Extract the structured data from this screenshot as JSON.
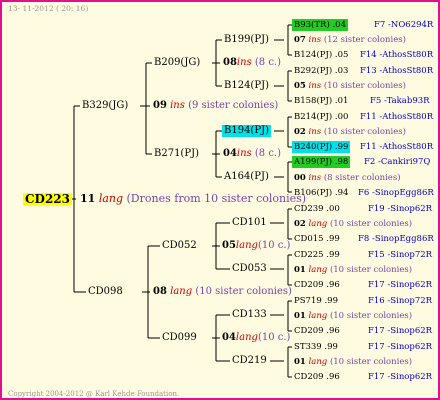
{
  "date": "13- 11-2012 ( 20: 16)",
  "copyright": "Copyright 2004-2012 @ Karl Kehde Foundation.",
  "root": {
    "id": "CD223",
    "num": "11",
    "type": "lang",
    "desc": "(Drones from 10 sister colonies)"
  },
  "b1": {
    "id": "B329(JG)",
    "num": "09",
    "type": "ins",
    "desc": "(9 sister colonies)"
  },
  "b2": {
    "id": "CD098",
    "num": "08",
    "type": "lang",
    "desc": "(10 sister colonies)"
  },
  "b11": {
    "id": "B209(JG)",
    "num": "08",
    "type": "ins",
    "desc": "(8 c.)"
  },
  "b12": {
    "id": "B271(PJ)",
    "num": "04",
    "type": "ins",
    "desc": "(8 c.)"
  },
  "b21": {
    "id": "CD052",
    "num": "05",
    "type": "lang",
    "desc": "(10 c.)"
  },
  "b22": {
    "id": "CD099",
    "num": "04",
    "type": "lang",
    "desc": "(10 c.)"
  },
  "g": [
    {
      "id": "B199(PJ)"
    },
    {
      "id": "B124(PJ)"
    },
    {
      "id": "B194(PJ)"
    },
    {
      "id": "A164(PJ)"
    },
    {
      "id": "CD101"
    },
    {
      "id": "CD053"
    },
    {
      "id": "CD133"
    },
    {
      "id": "CD219"
    }
  ],
  "r": [
    {
      "id": "B93(TR) .04",
      "num": "",
      "type": "",
      "desc": "",
      "ref": "F7 -NO6294R"
    },
    {
      "id": "",
      "num": "07",
      "type": "ins",
      "desc": "(12 sister colonies)",
      "ref": ""
    },
    {
      "id": "B124(PJ) .05",
      "num": "",
      "type": "",
      "desc": "",
      "ref": "F14 -AthosSt80R"
    },
    {
      "id": "B292(PJ) .03",
      "num": "",
      "type": "",
      "desc": "",
      "ref": "F13 -AthosSt80R"
    },
    {
      "id": "",
      "num": "05",
      "type": "ins",
      "desc": "(10 sister colonies)",
      "ref": ""
    },
    {
      "id": "B158(PJ) .01",
      "num": "",
      "type": "",
      "desc": "",
      "ref": "F5 -Takab93R"
    },
    {
      "id": "B214(PJ) .00",
      "num": "",
      "type": "",
      "desc": "",
      "ref": "F11 -AthosSt80R"
    },
    {
      "id": "",
      "num": "02",
      "type": "ins",
      "desc": "(10 sister colonies)",
      "ref": ""
    },
    {
      "id": "B240(PJ) .99",
      "num": "",
      "type": "",
      "desc": "",
      "ref": "F11 -AthosSt80R"
    },
    {
      "id": "A199(PJ) .98",
      "num": "",
      "type": "",
      "desc": "",
      "ref": "F2 -Cankiri97Q"
    },
    {
      "id": "",
      "num": "00",
      "type": "ins",
      "desc": "(8 sister colonies)",
      "ref": ""
    },
    {
      "id": "B106(PJ) .94",
      "num": "",
      "type": "",
      "desc": "",
      "ref": "F6 -SinopEgg86R"
    },
    {
      "id": "CD239 .00",
      "num": "",
      "type": "",
      "desc": "",
      "ref": "F19 -Sinop62R"
    },
    {
      "id": "",
      "num": "02",
      "type": "lang",
      "desc": "(10 sister colonies)",
      "ref": ""
    },
    {
      "id": "CD015 .99",
      "num": "",
      "type": "",
      "desc": "",
      "ref": "F8 -SinopEgg86R"
    },
    {
      "id": "CD225 .99",
      "num": "",
      "type": "",
      "desc": "",
      "ref": "F15 -Sinop72R"
    },
    {
      "id": "",
      "num": "01",
      "type": "lang",
      "desc": "(10 sister colonies)",
      "ref": ""
    },
    {
      "id": "CD209 .96",
      "num": "",
      "type": "",
      "desc": "",
      "ref": "F17 -Sinop62R"
    },
    {
      "id": "PS719 .99",
      "num": "",
      "type": "",
      "desc": "",
      "ref": "F16 -Sinop72R"
    },
    {
      "id": "",
      "num": "01",
      "type": "lang",
      "desc": "(10 sister colonies)",
      "ref": ""
    },
    {
      "id": "CD209 .96",
      "num": "",
      "type": "",
      "desc": "",
      "ref": "F17 -Sinop62R"
    },
    {
      "id": "ST339 .99",
      "num": "",
      "type": "",
      "desc": "",
      "ref": "F17 -Sinop62R"
    },
    {
      "id": "",
      "num": "01",
      "type": "lang",
      "desc": "(10 sister colonies)",
      "ref": ""
    },
    {
      "id": "CD209 .96",
      "num": "",
      "type": "",
      "desc": "",
      "ref": "F17 -Sinop62R"
    }
  ]
}
